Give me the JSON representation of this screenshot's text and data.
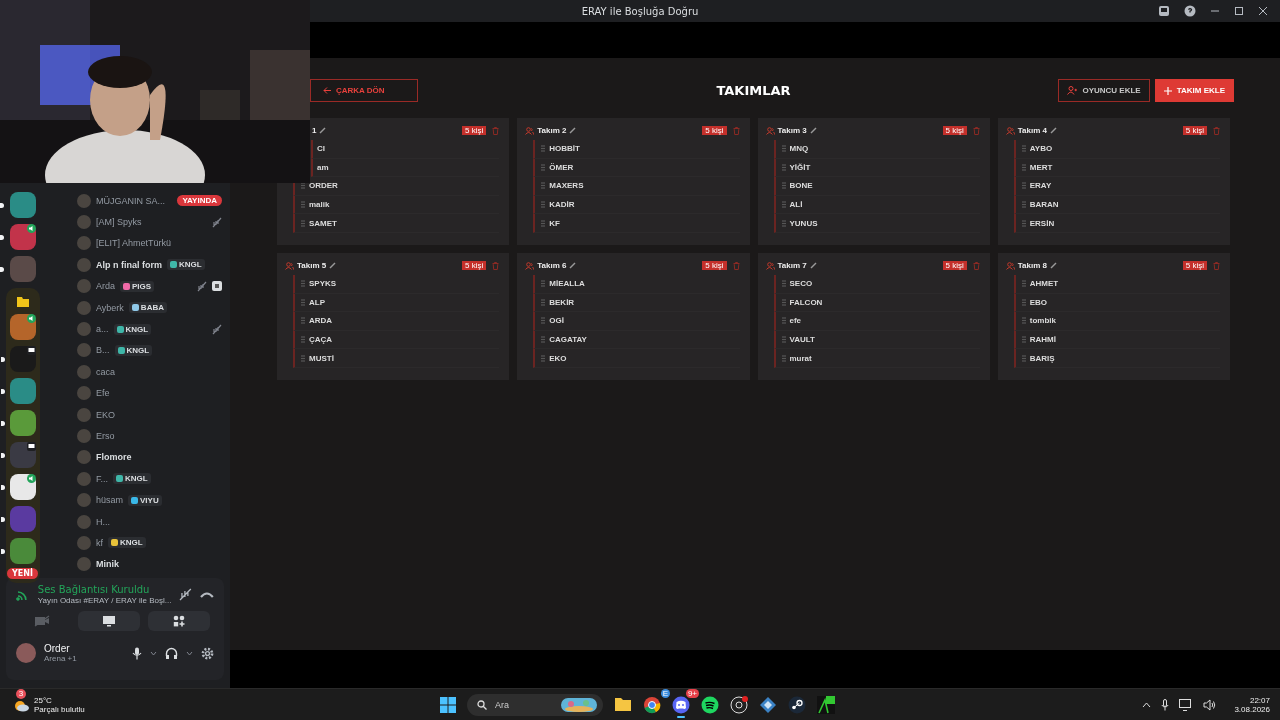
{
  "window": {
    "title": "ERAY ile Boşluğa Doğru"
  },
  "page": {
    "back_button": "ÇARKA DÖN",
    "title": "TAKIMLAR",
    "add_player_button": "OYUNCU EKLE",
    "add_team_button": "TAKIM EKLE"
  },
  "teams": [
    {
      "title": "1",
      "icon": false,
      "count": "5 kişi",
      "members": [
        {
          "name": "CI",
          "handle": false
        },
        {
          "name": "am",
          "handle": false
        },
        {
          "name": "ORDER",
          "handle": true
        },
        {
          "name": "malik",
          "handle": true
        },
        {
          "name": "SAMET",
          "handle": true
        }
      ]
    },
    {
      "title": "Takım 2",
      "icon": true,
      "count": "5 kişi",
      "members": [
        {
          "name": "HOBBİT",
          "handle": true
        },
        {
          "name": "ÖMER",
          "handle": true
        },
        {
          "name": "MAXERS",
          "handle": true
        },
        {
          "name": "KADİR",
          "handle": true
        },
        {
          "name": "KF",
          "handle": true
        }
      ]
    },
    {
      "title": "Takım 3",
      "icon": true,
      "count": "5 kişi",
      "members": [
        {
          "name": "MNQ",
          "handle": true
        },
        {
          "name": "YİĞİT",
          "handle": true
        },
        {
          "name": "BONE",
          "handle": true
        },
        {
          "name": "ALİ",
          "handle": true
        },
        {
          "name": "YUNUS",
          "handle": true
        }
      ]
    },
    {
      "title": "Takım 4",
      "icon": true,
      "count": "5 kişi",
      "members": [
        {
          "name": "AYBO",
          "handle": true
        },
        {
          "name": "MERT",
          "handle": true
        },
        {
          "name": "ERAY",
          "handle": true
        },
        {
          "name": "BARAN",
          "handle": true
        },
        {
          "name": "ERSİN",
          "handle": true
        }
      ]
    },
    {
      "title": "Takım 5",
      "icon": true,
      "count": "5 kişi",
      "members": [
        {
          "name": "SPYKS",
          "handle": true
        },
        {
          "name": "ALP",
          "handle": true
        },
        {
          "name": "ARDA",
          "handle": true
        },
        {
          "name": "ÇAÇA",
          "handle": true
        },
        {
          "name": "MUSTİ",
          "handle": true
        }
      ]
    },
    {
      "title": "Takım 6",
      "icon": true,
      "count": "5 kişi",
      "members": [
        {
          "name": "MİEALLA",
          "handle": true
        },
        {
          "name": "BEKİR",
          "handle": true
        },
        {
          "name": "OGİ",
          "handle": true
        },
        {
          "name": "CAGATAY",
          "handle": true
        },
        {
          "name": "EKO",
          "handle": true
        }
      ]
    },
    {
      "title": "Takım 7",
      "icon": true,
      "count": "5 kişi",
      "members": [
        {
          "name": "SECO",
          "handle": true
        },
        {
          "name": "FALCON",
          "handle": true
        },
        {
          "name": "efe",
          "handle": true
        },
        {
          "name": "VAULT",
          "handle": true
        },
        {
          "name": "murat",
          "handle": true
        }
      ]
    },
    {
      "title": "Takım 8",
      "icon": true,
      "count": "5 kişi",
      "members": [
        {
          "name": "AHMET",
          "handle": true
        },
        {
          "name": "EBO",
          "handle": true
        },
        {
          "name": "tombik",
          "handle": true
        },
        {
          "name": "RAHMİ",
          "handle": true
        },
        {
          "name": "BARIŞ",
          "handle": true
        }
      ]
    }
  ],
  "servers": [
    {
      "kind": "server",
      "color": "#2a8c86",
      "unread": true
    },
    {
      "kind": "server",
      "color": "#c2334a",
      "unread": true,
      "badge": {
        "kind": "voice"
      }
    },
    {
      "kind": "server",
      "color": "#5a4a48",
      "unread": true
    },
    {
      "kind": "folder",
      "children": [
        {
          "kind": "server",
          "color": "#b5652a",
          "badge": {
            "kind": "voice"
          }
        },
        {
          "kind": "server",
          "color": "#1a1a1a",
          "unread": true,
          "badge": {
            "kind": "chat"
          }
        },
        {
          "kind": "server",
          "color": "#2a8c86",
          "unread": true
        },
        {
          "kind": "server",
          "color": "#5a9a3a",
          "unread": true
        },
        {
          "kind": "server",
          "color": "#3a3a44",
          "unread": true,
          "badge": {
            "kind": "chat"
          }
        },
        {
          "kind": "server",
          "color": "#e8e8e8",
          "unread": true,
          "badge": {
            "kind": "voice"
          }
        },
        {
          "kind": "server",
          "color": "#5a3aa0",
          "unread": true
        },
        {
          "kind": "server",
          "color": "#4a8a3a",
          "unread": true
        }
      ]
    }
  ],
  "new_badge": "YENİ",
  "voice_members": [
    {
      "name": "MÜJGANIN SA...",
      "bold": false,
      "live": "YAYINDA"
    },
    {
      "name": "[AM] Spyks",
      "bold": false,
      "icons": [
        {
          "kind": "deafened"
        }
      ]
    },
    {
      "name": "[ELIT] AhmetTürkü",
      "bold": false
    },
    {
      "name": "Alp n final form",
      "bold": true,
      "tag": {
        "text": "KNGL",
        "color": "#3fb6a8"
      }
    },
    {
      "name": "Arda",
      "bold": false,
      "tag": {
        "text": "PIGS",
        "color": "#f06aa8"
      },
      "icons": [
        {
          "kind": "deafened"
        },
        {
          "kind": "activity"
        }
      ]
    },
    {
      "name": "Ayberk",
      "bold": false,
      "tag": {
        "text": "BABA",
        "color": "#8fc8e8"
      }
    },
    {
      "name": "a...",
      "bold": false,
      "tag": {
        "text": "KNGL",
        "color": "#3fb6a8"
      },
      "icons": [
        {
          "kind": "deafened"
        }
      ]
    },
    {
      "name": "B...",
      "bold": false,
      "tag": {
        "text": "KNGL",
        "color": "#3fb6a8"
      }
    },
    {
      "name": "caca",
      "bold": false
    },
    {
      "name": "Efe",
      "bold": false
    },
    {
      "name": "EKO",
      "bold": false
    },
    {
      "name": "Erso",
      "bold": false
    },
    {
      "name": "Flomore",
      "bold": true
    },
    {
      "name": "F...",
      "bold": false,
      "tag": {
        "text": "KNGL",
        "color": "#3fb6a8"
      }
    },
    {
      "name": "hüsam",
      "bold": false,
      "tag": {
        "text": "VIYU",
        "color": "#3ab8e8"
      }
    },
    {
      "name": "H...",
      "bold": false
    },
    {
      "name": "kf",
      "bold": false,
      "tag": {
        "text": "KNGL",
        "color": "#e8c23a"
      }
    },
    {
      "name": "Minik",
      "bold": true
    }
  ],
  "voice_panel": {
    "status": "Ses Bağlantısı Kuruldu",
    "channel": "Yayın Odası #ERAY / ERAY ile Boşl..."
  },
  "user": {
    "name": "Order",
    "activity": "Arena +1"
  },
  "taskbar": {
    "temperature": "25°C",
    "weather": "Parçalı bulutlu",
    "weather_badge": "3",
    "search": "Ara",
    "chrome_badge": "E",
    "discord_badge": "9+",
    "time": "22:07",
    "date": "3.08.2026"
  }
}
